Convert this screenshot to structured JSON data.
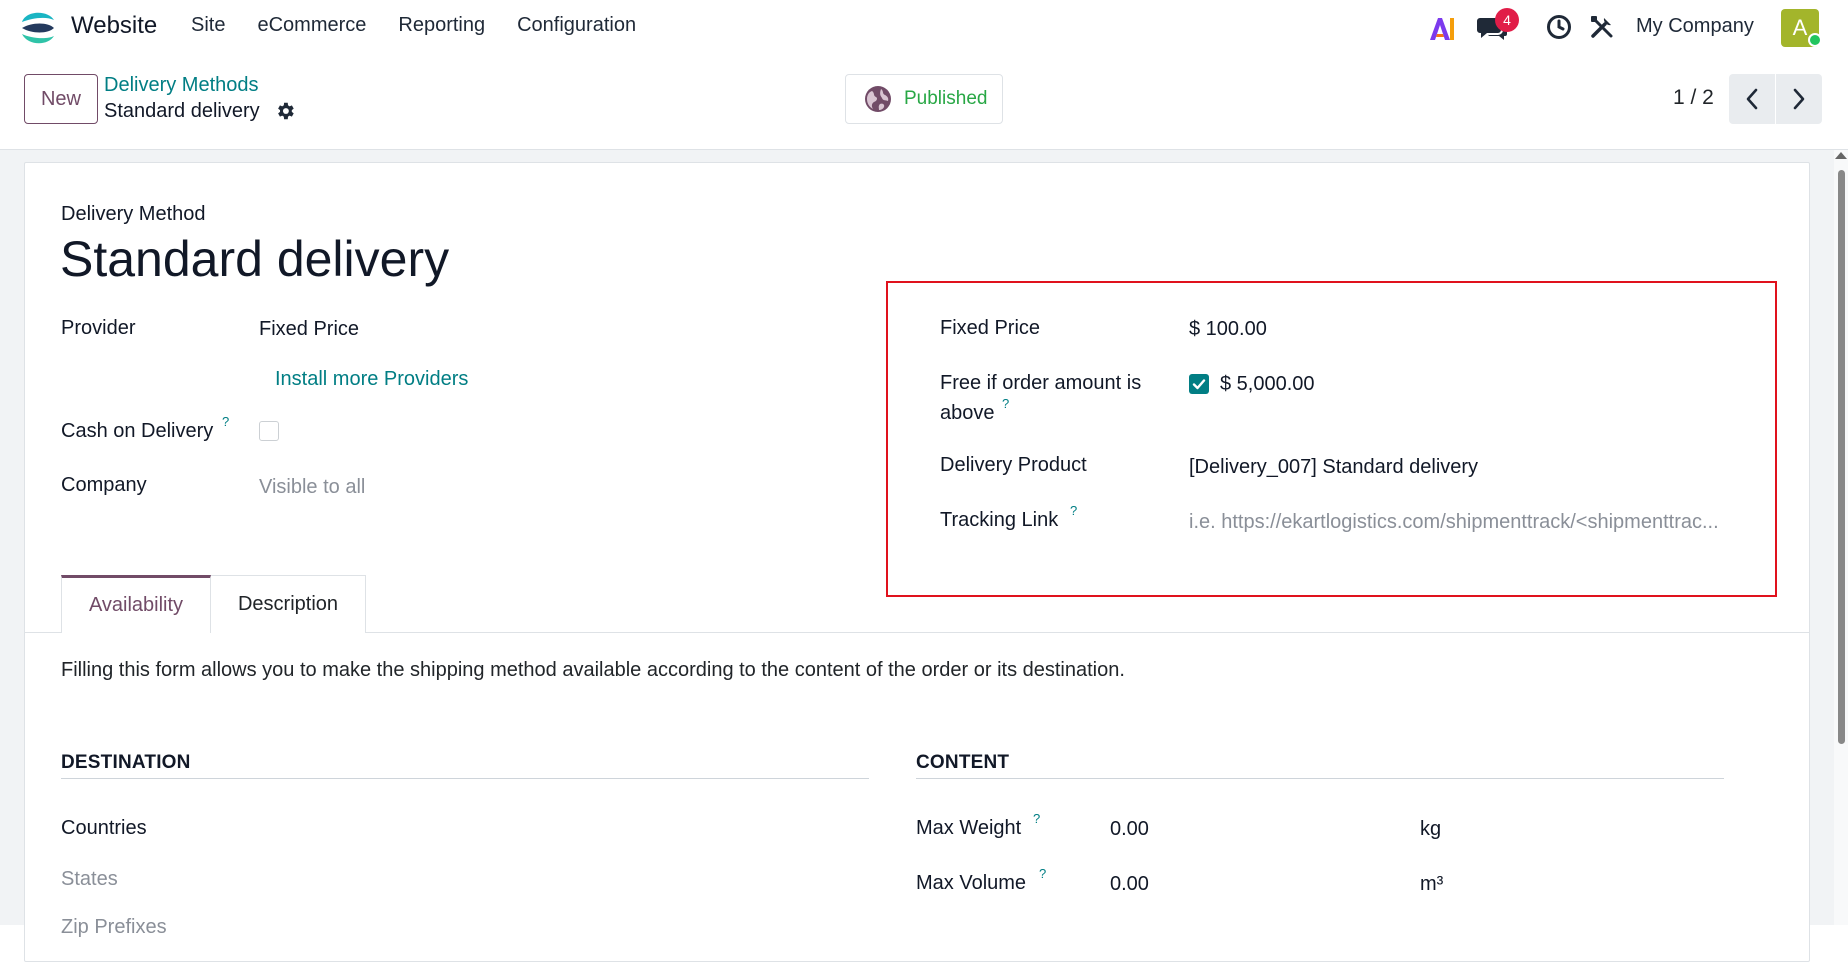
{
  "navbar": {
    "app_name": "Website",
    "menu": [
      "Site",
      "eCommerce",
      "Reporting",
      "Configuration"
    ],
    "chat_count": "4",
    "company": "My Company",
    "avatar_initial": "A"
  },
  "control_panel": {
    "new_label": "New",
    "breadcrumb_parent": "Delivery Methods",
    "breadcrumb_current": "Standard delivery",
    "published_label": "Published",
    "pager": "1 / 2"
  },
  "form": {
    "title_label": "Delivery Method",
    "title": "Standard delivery",
    "provider_label": "Provider",
    "provider_value": "Fixed Price",
    "install_link": "Install more Providers",
    "cod_label": "Cash on Delivery",
    "company_label": "Company",
    "company_placeholder": "Visible to all",
    "help_mark": "?",
    "right": {
      "fixed_price_label": "Fixed Price",
      "fixed_price_value": "$ 100.00",
      "free_label_1": "Free if order amount is",
      "free_label_2": "above",
      "free_value": "$ 5,000.00",
      "free_checked": true,
      "product_label": "Delivery Product",
      "product_value": "[Delivery_007] Standard delivery",
      "tracking_label": "Tracking Link",
      "tracking_placeholder": "i.e. https://ekartlogistics.com/shipmenttrack/<shipmenttrac..."
    }
  },
  "tabs": [
    {
      "label": "Availability",
      "active": true
    },
    {
      "label": "Description",
      "active": false
    }
  ],
  "availability": {
    "description": "Filling this form allows you to make the shipping method available according to the content of the order or its destination.",
    "destination_title": "DESTINATION",
    "countries_label": "Countries",
    "states_label": "States",
    "zip_label": "Zip Prefixes",
    "content_title": "CONTENT",
    "max_weight_label": "Max Weight",
    "max_weight_value": "0.00",
    "max_weight_unit": "kg",
    "max_volume_label": "Max Volume",
    "max_volume_value": "0.00",
    "max_volume_unit": "m³"
  },
  "colors": {
    "brand": "#714b67",
    "link": "#017e84",
    "published": "#28a745",
    "highlight": "#e0121d"
  }
}
